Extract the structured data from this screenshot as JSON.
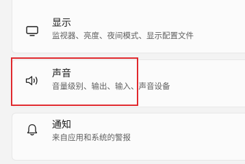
{
  "settings": {
    "items": [
      {
        "title": "显示",
        "subtitle": "监视器、亮度、夜间模式、显示配置文件",
        "icon": "monitor-icon"
      },
      {
        "title": "声音",
        "subtitle": "音量级别、输出、输入、声音设备",
        "icon": "speaker-icon"
      },
      {
        "title": "通知",
        "subtitle": "来自应用和系统的警报",
        "icon": "bell-icon"
      }
    ]
  },
  "annotation": {
    "color": "#e0262b"
  }
}
